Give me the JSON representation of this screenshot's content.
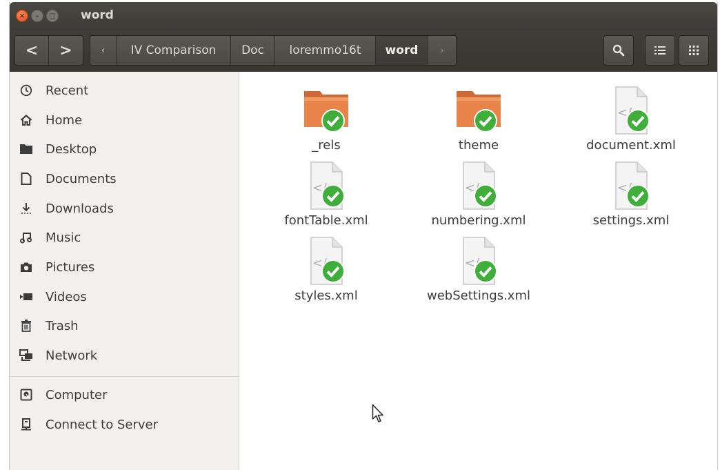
{
  "window": {
    "title": "word"
  },
  "toolbar": {
    "back_label": "<",
    "forward_label": ">",
    "path_scroll_left": "‹",
    "path_scroll_right": "›",
    "breadcrumbs": [
      "IV Comparison",
      "Doc",
      "loremmo16t",
      "word"
    ]
  },
  "sidebar": {
    "items": [
      {
        "label": "Recent",
        "icon": "clock-icon"
      },
      {
        "label": "Home",
        "icon": "home-icon"
      },
      {
        "label": "Desktop",
        "icon": "folder-icon"
      },
      {
        "label": "Documents",
        "icon": "document-icon"
      },
      {
        "label": "Downloads",
        "icon": "download-icon"
      },
      {
        "label": "Music",
        "icon": "music-icon"
      },
      {
        "label": "Pictures",
        "icon": "camera-icon"
      },
      {
        "label": "Videos",
        "icon": "video-icon"
      },
      {
        "label": "Trash",
        "icon": "trash-icon"
      },
      {
        "label": "Network",
        "icon": "network-icon"
      }
    ],
    "devices": [
      {
        "label": "Computer",
        "icon": "computer-icon"
      },
      {
        "label": "Connect to Server",
        "icon": "server-icon"
      }
    ]
  },
  "files": [
    {
      "name": "_rels",
      "type": "folder"
    },
    {
      "name": "theme",
      "type": "folder"
    },
    {
      "name": "document.xml",
      "type": "xml"
    },
    {
      "name": "fontTable.xml",
      "type": "xml"
    },
    {
      "name": "numbering.xml",
      "type": "xml"
    },
    {
      "name": "settings.xml",
      "type": "xml"
    },
    {
      "name": "styles.xml",
      "type": "xml"
    },
    {
      "name": "webSettings.xml",
      "type": "xml"
    }
  ],
  "colors": {
    "accent": "#e95420",
    "sync_badge": "#3fae3b",
    "folder": "#e8844a"
  }
}
